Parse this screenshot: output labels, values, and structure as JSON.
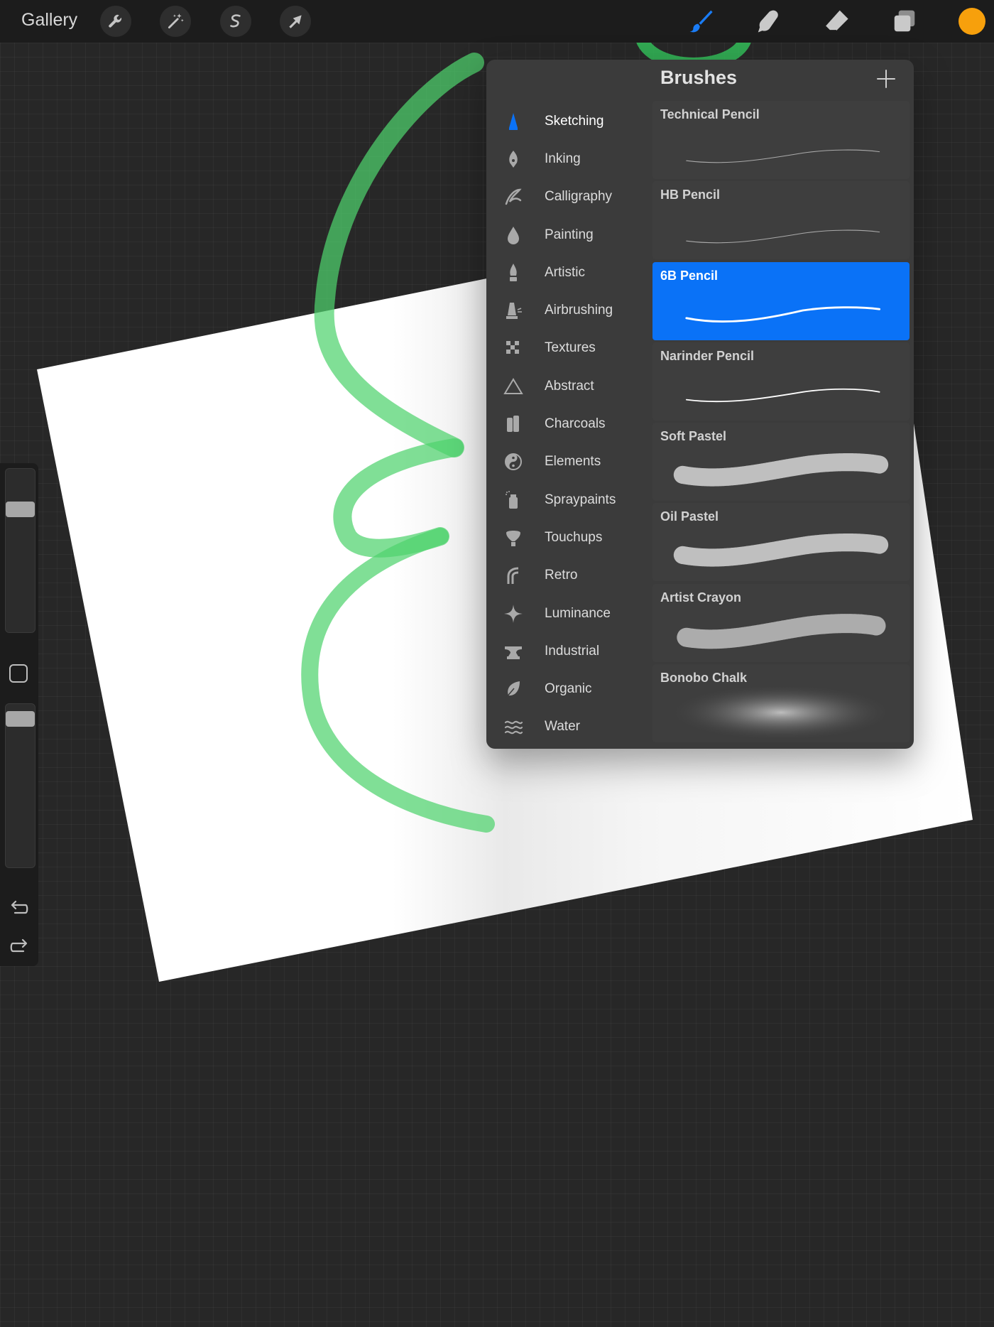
{
  "app": {
    "gallery_label": "Gallery",
    "left_tools": [
      {
        "name": "actions",
        "icon": "wrench-icon"
      },
      {
        "name": "adjustments",
        "icon": "magic-wand-icon"
      },
      {
        "name": "selection",
        "icon": "selection-s-icon"
      },
      {
        "name": "transform",
        "icon": "arrow-cursor-icon"
      }
    ],
    "right_tools": [
      {
        "name": "brush",
        "icon": "brush-icon",
        "active": true
      },
      {
        "name": "smudge",
        "icon": "smudge-finger-icon"
      },
      {
        "name": "eraser",
        "icon": "eraser-icon"
      },
      {
        "name": "layers",
        "icon": "layers-icon"
      }
    ],
    "current_color": "#f7a00c",
    "accent_color": "#0a72f7"
  },
  "sidebar": {
    "brush_size_level": 0.78,
    "opacity_level": 0.95,
    "modify_icon": "square-modify-icon",
    "undo_icon": "undo-arrow-icon",
    "redo_icon": "redo-arrow-icon"
  },
  "brushes_panel": {
    "title": "Brushes",
    "add_icon": "plus-icon",
    "categories": [
      {
        "label": "Sketching",
        "icon": "pencil-tip-icon",
        "active": true
      },
      {
        "label": "Inking",
        "icon": "pen-nib-icon"
      },
      {
        "label": "Calligraphy",
        "icon": "calligraphy-icon"
      },
      {
        "label": "Painting",
        "icon": "paint-drop-icon"
      },
      {
        "label": "Artistic",
        "icon": "artistic-brush-icon"
      },
      {
        "label": "Airbrushing",
        "icon": "airbrush-icon"
      },
      {
        "label": "Textures",
        "icon": "checker-texture-icon"
      },
      {
        "label": "Abstract",
        "icon": "triangle-icon"
      },
      {
        "label": "Charcoals",
        "icon": "charcoal-icon"
      },
      {
        "label": "Elements",
        "icon": "yin-yang-icon"
      },
      {
        "label": "Spraypaints",
        "icon": "spray-can-icon"
      },
      {
        "label": "Touchups",
        "icon": "touchup-brush-icon"
      },
      {
        "label": "Retro",
        "icon": "retro-stripes-icon"
      },
      {
        "label": "Luminance",
        "icon": "sparkle-icon"
      },
      {
        "label": "Industrial",
        "icon": "anvil-icon"
      },
      {
        "label": "Organic",
        "icon": "leaf-icon"
      },
      {
        "label": "Water",
        "icon": "waves-icon"
      }
    ],
    "brushes": [
      {
        "name": "Technical Pencil",
        "stroke": "thin"
      },
      {
        "name": "HB Pencil",
        "stroke": "thin"
      },
      {
        "name": "6B Pencil",
        "stroke": "medium",
        "selected": true
      },
      {
        "name": "Narinder Pencil",
        "stroke": "line"
      },
      {
        "name": "Soft Pastel",
        "stroke": "pastel"
      },
      {
        "name": "Oil Pastel",
        "stroke": "pastel"
      },
      {
        "name": "Artist Crayon",
        "stroke": "crayon"
      },
      {
        "name": "Bonobo Chalk",
        "stroke": "chalk"
      }
    ]
  }
}
